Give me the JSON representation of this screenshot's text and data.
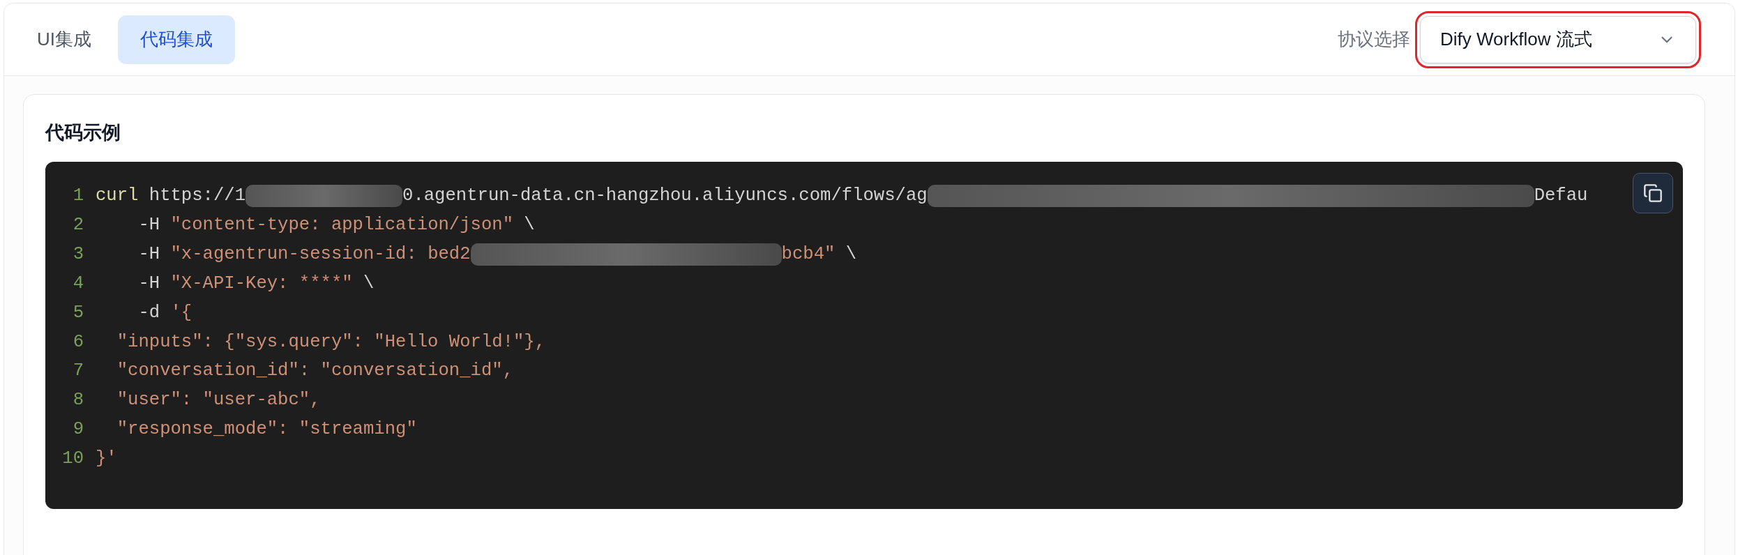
{
  "tabs": [
    {
      "label": "UI集成",
      "selected": false
    },
    {
      "label": "代码集成",
      "selected": true
    }
  ],
  "protocol": {
    "label": "协议选择",
    "value": "Dify Workflow 流式",
    "highlighted": true
  },
  "code_card": {
    "title": "代码示例",
    "lines": [
      {
        "number": "1",
        "tokens": [
          {
            "kind": "command",
            "text": "curl"
          },
          {
            "kind": "plain",
            "text": " https://1"
          },
          {
            "kind": "blur"
          },
          {
            "kind": "plain",
            "text": "0.agentrun-data.cn-hangzhou.aliyuncs.com/flows/ag"
          },
          {
            "kind": "blur"
          },
          {
            "kind": "plain",
            "text": "Defau"
          }
        ]
      },
      {
        "number": "2",
        "tokens": [
          {
            "kind": "plain",
            "text": "    -H "
          },
          {
            "kind": "string",
            "text": "\"content-type: application/json\""
          },
          {
            "kind": "plain",
            "text": " \\"
          }
        ]
      },
      {
        "number": "3",
        "tokens": [
          {
            "kind": "plain",
            "text": "    -H "
          },
          {
            "kind": "string",
            "text": "\"x-agentrun-session-id: bed2"
          },
          {
            "kind": "blur"
          },
          {
            "kind": "string",
            "text": "bcb4\""
          },
          {
            "kind": "plain",
            "text": " \\"
          }
        ]
      },
      {
        "number": "4",
        "tokens": [
          {
            "kind": "plain",
            "text": "    -H "
          },
          {
            "kind": "string",
            "text": "\"X-API-Key: ****\""
          },
          {
            "kind": "plain",
            "text": " \\"
          }
        ]
      },
      {
        "number": "5",
        "tokens": [
          {
            "kind": "plain",
            "text": "    -d "
          },
          {
            "kind": "string",
            "text": "'{"
          }
        ]
      },
      {
        "number": "6",
        "tokens": [
          {
            "kind": "string",
            "text": "  \"inputs\": {\"sys.query\": \"Hello World!\"},"
          }
        ]
      },
      {
        "number": "7",
        "tokens": [
          {
            "kind": "string",
            "text": "  \"conversation_id\": \"conversation_id\","
          }
        ]
      },
      {
        "number": "8",
        "tokens": [
          {
            "kind": "string",
            "text": "  \"user\": \"user-abc\","
          }
        ]
      },
      {
        "number": "9",
        "tokens": [
          {
            "kind": "string",
            "text": "  \"response_mode\": \"streaming\""
          }
        ]
      },
      {
        "number": "10",
        "tokens": [
          {
            "kind": "string",
            "text": "}'"
          }
        ]
      }
    ]
  }
}
